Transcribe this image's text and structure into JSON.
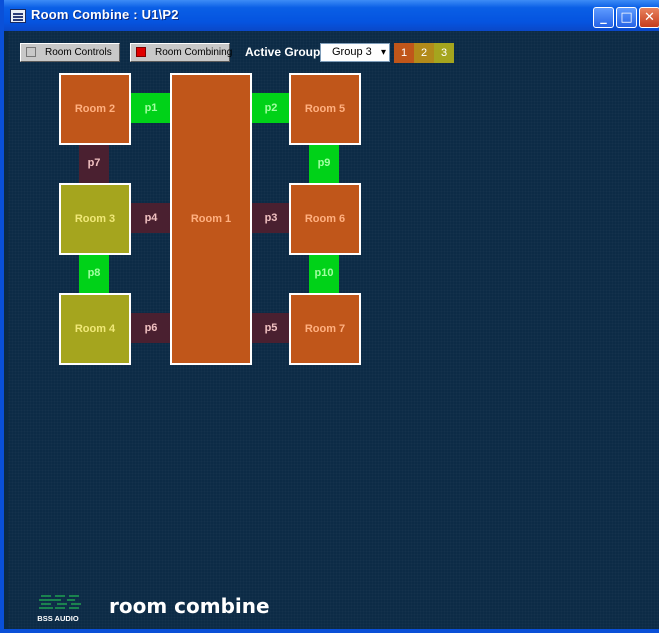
{
  "window": {
    "title": "Room Combine : U1\\P2",
    "controls": {
      "minimize": "_",
      "maximize": "□",
      "close": "✕"
    }
  },
  "toolbar": {
    "room_controls": {
      "label": "Room Controls",
      "led": "off"
    },
    "room_combining": {
      "label": "Room Combining",
      "led": "on"
    },
    "active_group_label": "Active Group",
    "group_select": {
      "value": "Group 3",
      "arrow": "▾"
    },
    "groups": [
      {
        "label": "1",
        "color": "#c0561a"
      },
      {
        "label": "2",
        "color": "#b28a1a"
      },
      {
        "label": "3",
        "color": "#a5a51e"
      }
    ]
  },
  "colors": {
    "room_group1": "#c0561a",
    "room_group3": "#a5a51e",
    "room_label_group1": "#ffb080",
    "room_label_group3": "#f0e878",
    "partition_open": "#00d218",
    "partition_closed": "#4a2030",
    "partition_open_text": "#a0ffa0",
    "partition_closed_text": "#f0c0c0"
  },
  "rooms": [
    {
      "id": "room-1",
      "label": "Room 1",
      "group": 1
    },
    {
      "id": "room-2",
      "label": "Room 2",
      "group": 1
    },
    {
      "id": "room-3",
      "label": "Room 3",
      "group": 3
    },
    {
      "id": "room-4",
      "label": "Room 4",
      "group": 3
    },
    {
      "id": "room-5",
      "label": "Room 5",
      "group": 1
    },
    {
      "id": "room-6",
      "label": "Room 6",
      "group": 1
    },
    {
      "id": "room-7",
      "label": "Room 7",
      "group": 1
    }
  ],
  "partitions": [
    {
      "id": "p1",
      "label": "p1",
      "state": "open"
    },
    {
      "id": "p2",
      "label": "p2",
      "state": "open"
    },
    {
      "id": "p3",
      "label": "p3",
      "state": "closed"
    },
    {
      "id": "p4",
      "label": "p4",
      "state": "closed"
    },
    {
      "id": "p5",
      "label": "p5",
      "state": "closed"
    },
    {
      "id": "p6",
      "label": "p6",
      "state": "closed"
    },
    {
      "id": "p7",
      "label": "p7",
      "state": "closed"
    },
    {
      "id": "p8",
      "label": "p8",
      "state": "open"
    },
    {
      "id": "p9",
      "label": "p9",
      "state": "open"
    },
    {
      "id": "p10",
      "label": "p10",
      "state": "open"
    }
  ],
  "footer": {
    "logo_text": "BSS AUDIO",
    "brand_text": "room combine"
  }
}
